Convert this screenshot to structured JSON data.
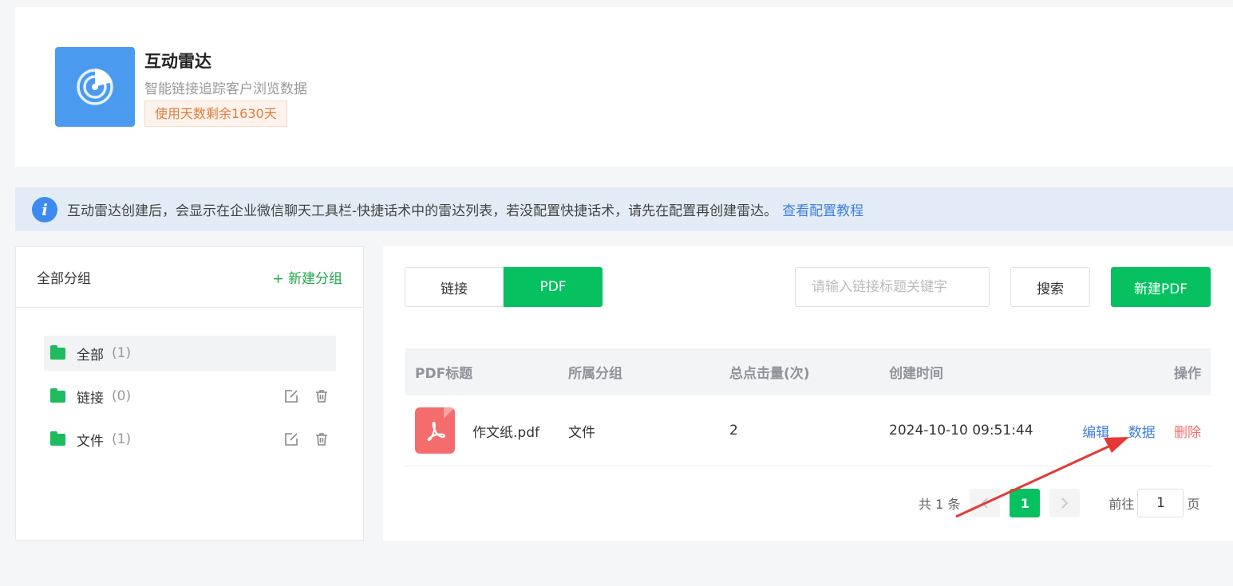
{
  "app": {
    "title": "互动雷达",
    "subtitle": "智能链接追踪客户浏览数据",
    "badge": "使用天数剩余1630天",
    "logo_icon": "radar-icon"
  },
  "notice": {
    "icon": "info-icon",
    "text": "互动雷达创建后，会显示在企业微信聊天工具栏-快捷话术中的雷达列表，若没配置快捷话术，请先在配置再创建雷达。",
    "link": "查看配置教程"
  },
  "sidebar": {
    "title": "全部分组",
    "new_group": "+ 新建分组",
    "groups": [
      {
        "name": "全部",
        "count": "(1)",
        "active": true
      },
      {
        "name": "链接",
        "count": "(0)",
        "active": false
      },
      {
        "name": "文件",
        "count": "(1)",
        "active": false
      }
    ]
  },
  "toolbar": {
    "tabs": [
      "链接",
      "PDF"
    ],
    "active_tab": "PDF",
    "search_placeholder": "请输入链接标题关键字",
    "search_label": "搜索",
    "new_label": "新建PDF"
  },
  "table": {
    "headers": [
      "PDF标题",
      "所属分组",
      "总点击量(次)",
      "创建时间",
      "操作"
    ],
    "rows": [
      {
        "title": "作文纸.pdf",
        "group": "文件",
        "clicks": "2",
        "created": "2024-10-10 09:51:44",
        "actions": [
          "编辑",
          "数据",
          "删除"
        ]
      }
    ]
  },
  "pagination": {
    "total": "共 1 条",
    "current": "1",
    "goto_label": "前往",
    "goto_value": "1",
    "page_suffix": "页"
  },
  "colors": {
    "accent": "#07c160",
    "link": "#3d7fe0",
    "danger": "#f56c6c",
    "annotation_arrow": "#e53935"
  }
}
